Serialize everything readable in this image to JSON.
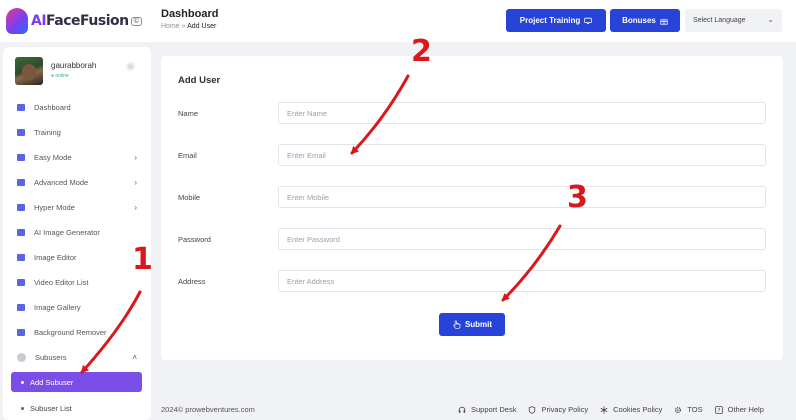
{
  "app": {
    "logo_text_a": "AI",
    "logo_text_b": "FaceFusion",
    "logo_badge": "©"
  },
  "header": {
    "title": "Dashboard",
    "breadcrumb_home": "Home",
    "breadcrumb_sep": "»",
    "breadcrumb_current": "Add User",
    "project_training_label": "Project Training",
    "bonuses_label": "Bonuses",
    "language_value": "Select Language"
  },
  "profile": {
    "name": "gaurabborah",
    "status": "● online"
  },
  "sidebar": {
    "items": [
      {
        "label": "Dashboard",
        "icon": "dashboard-icon"
      },
      {
        "label": "Training",
        "icon": "training-icon"
      },
      {
        "label": "Easy Mode",
        "icon": "easy-mode-icon",
        "arrow": "›"
      },
      {
        "label": "Advanced Mode",
        "icon": "advanced-mode-icon",
        "arrow": "›"
      },
      {
        "label": "Hyper Mode",
        "icon": "hyper-mode-icon",
        "arrow": "›"
      },
      {
        "label": "AI Image Generator",
        "icon": "image-generator-icon"
      },
      {
        "label": "Image Editor",
        "icon": "image-editor-icon"
      },
      {
        "label": "Video Editor List",
        "icon": "video-editor-icon"
      },
      {
        "label": "Image Gallery",
        "icon": "image-gallery-icon"
      },
      {
        "label": "Background Remover",
        "icon": "background-remover-icon"
      },
      {
        "label": "Subusers",
        "icon": "subusers-icon",
        "arrow": "˄"
      }
    ],
    "children": [
      {
        "label": "Add Subuser",
        "active": true
      },
      {
        "label": "Subuser List",
        "active": false
      }
    ]
  },
  "form": {
    "title": "Add User",
    "fields": [
      {
        "label": "Name",
        "placeholder": "Enter Name",
        "value": ""
      },
      {
        "label": "Email",
        "placeholder": "Enter Email",
        "value": ""
      },
      {
        "label": "Mobile",
        "placeholder": "Enter Mobile",
        "value": ""
      },
      {
        "label": "Password",
        "placeholder": "Enter Password",
        "value": ""
      },
      {
        "label": "Address",
        "placeholder": "Enter Address",
        "value": ""
      }
    ],
    "submit_label": "Submit"
  },
  "footer": {
    "copyright": "2024© prowebventures.com",
    "links": [
      "Support Desk",
      "Privacy Policy",
      "Cookies Policy",
      "TOS",
      "Other Help"
    ]
  },
  "annotations": {
    "labels": [
      "1",
      "2",
      "3"
    ],
    "color": "#d9181b"
  },
  "colors": {
    "primary": "#2743d8",
    "active_nav": "#7b4ee8",
    "nav_icon": "#5b63e6",
    "background": "#f1f2f6"
  }
}
